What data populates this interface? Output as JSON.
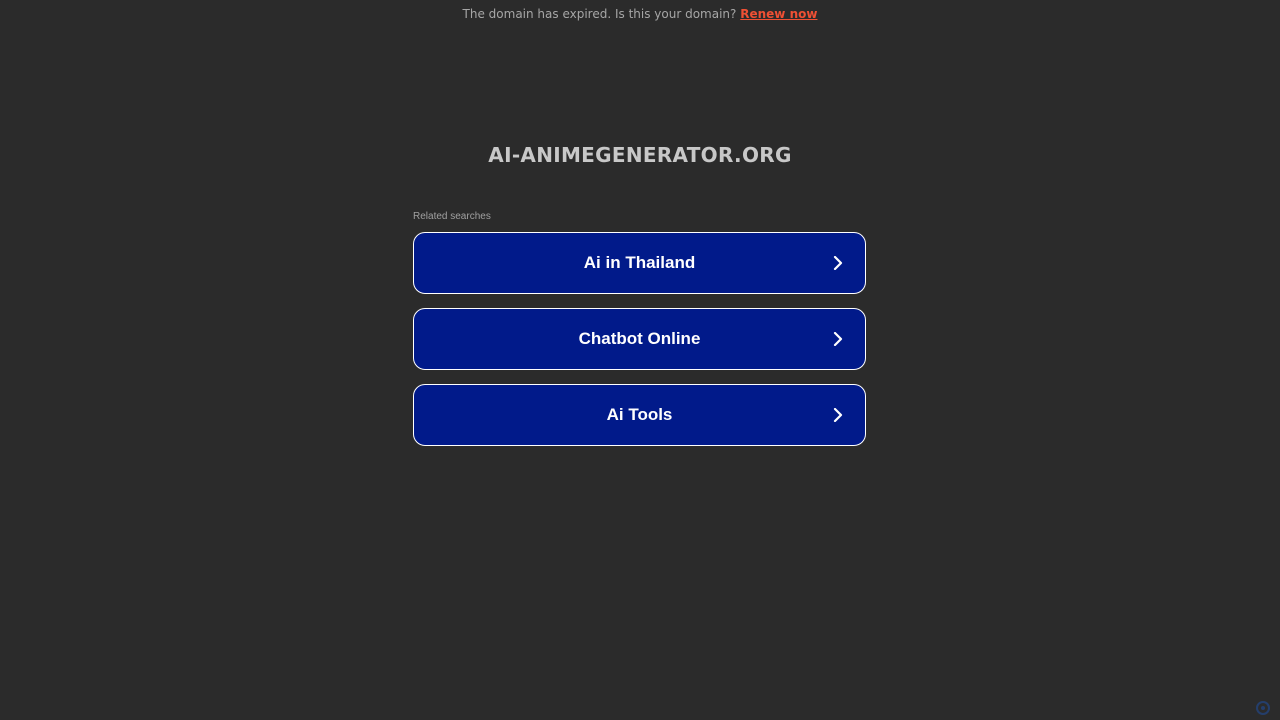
{
  "banner": {
    "text": "The domain has expired. Is this your domain?",
    "link_label": "Renew now"
  },
  "domain": {
    "title": "AI-ANIMEGENERATOR.ORG"
  },
  "related": {
    "label": "Related searches",
    "items": [
      {
        "label": "Ai in Thailand",
        "icon": "chevron-right-icon"
      },
      {
        "label": "Chatbot Online",
        "icon": "chevron-right-icon"
      },
      {
        "label": "Ai Tools",
        "icon": "chevron-right-icon"
      }
    ]
  },
  "corner_badge": {
    "text": "",
    "icon": "badge-icon"
  },
  "colors": {
    "background": "#2b2b2b",
    "button_fill": "#011a8a",
    "button_border": "#ffffff",
    "renew_link": "#ef5034",
    "title": "#c8c8c8"
  }
}
